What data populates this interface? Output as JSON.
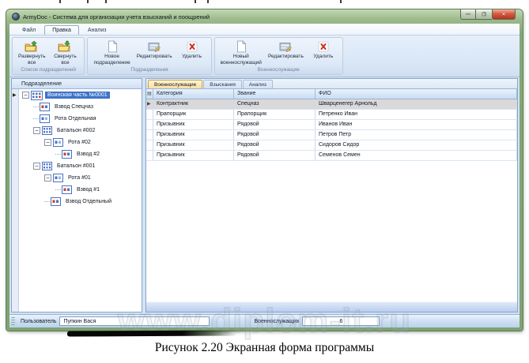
{
  "window": {
    "title": "ArmyDoc - Система для организации учета взысканий и поощрений"
  },
  "glyphs": {
    "minimize": "—",
    "maximize": "❐",
    "close": "✕",
    "row_marker": "▶",
    "collapse": "−",
    "grid_corner": "▤"
  },
  "ribbon": {
    "tabs": [
      {
        "label": "Файл",
        "active": false
      },
      {
        "label": "Правка",
        "active": true
      },
      {
        "label": "Анализ",
        "active": false
      }
    ],
    "groups": [
      {
        "caption": "Список подразделений",
        "buttons": [
          {
            "line1": "Развернуть",
            "line2": "все",
            "icon": "folder-expand"
          },
          {
            "line1": "Свернуть",
            "line2": "все",
            "icon": "folder-collapse"
          }
        ]
      },
      {
        "caption": "Подразделения",
        "buttons": [
          {
            "line1": "Новое",
            "line2": "подразделение",
            "icon": "new-document"
          },
          {
            "line1": "Редактировать",
            "line2": "",
            "icon": "edit-form"
          },
          {
            "line1": "Удалить",
            "line2": "",
            "icon": "delete"
          }
        ]
      },
      {
        "caption": "Военнослужащие",
        "buttons": [
          {
            "line1": "Новый",
            "line2": "военнослужащий",
            "icon": "new-document"
          },
          {
            "line1": "Редактировать",
            "line2": "",
            "icon": "edit-form"
          },
          {
            "line1": "Удалить",
            "line2": "",
            "icon": "delete"
          }
        ]
      }
    ]
  },
  "tree": {
    "header": "Подразделение",
    "items": [
      {
        "label": "Воинская часть №0001",
        "level": 0,
        "expandable": true,
        "icon": "unit",
        "selected": true
      },
      {
        "label": "Взвод Спецназ",
        "level": 1,
        "expandable": false,
        "icon": "platoon",
        "selected": false
      },
      {
        "label": "Рота Отдельная",
        "level": 1,
        "expandable": false,
        "icon": "company",
        "selected": false
      },
      {
        "label": "Батальон #002",
        "level": 1,
        "expandable": true,
        "icon": "battalion",
        "selected": false
      },
      {
        "label": "Рота #02",
        "level": 2,
        "expandable": true,
        "icon": "company",
        "selected": false
      },
      {
        "label": "Взвод #2",
        "level": 3,
        "expandable": false,
        "icon": "platoon",
        "selected": false
      },
      {
        "label": "Батальон #001",
        "level": 1,
        "expandable": true,
        "icon": "battalion",
        "selected": false
      },
      {
        "label": "Рота #01",
        "level": 2,
        "expandable": true,
        "icon": "company",
        "selected": false
      },
      {
        "label": "Взвод #1",
        "level": 3,
        "expandable": false,
        "icon": "platoon",
        "selected": false
      },
      {
        "label": "Взвод Отдельный",
        "level": 2,
        "expandable": false,
        "icon": "platoon",
        "selected": false
      }
    ]
  },
  "detail": {
    "tabs": [
      {
        "label": "Военнослужащие",
        "active": true
      },
      {
        "label": "Взыскания",
        "active": false
      },
      {
        "label": "Анализ",
        "active": false
      }
    ],
    "table": {
      "columns": [
        "Категория",
        "Звание",
        "ФИО"
      ],
      "selected_row": 0,
      "rows": [
        [
          "Контрактник",
          "Спецназ",
          "Шварценегер Арнольд"
        ],
        [
          "Прапорщик",
          "Прапорщик",
          "Петренко Иван"
        ],
        [
          "Призывник",
          "Рядовой",
          "Иванов Иван"
        ],
        [
          "Призывник",
          "Рядовой",
          "Петров Петр"
        ],
        [
          "Призывник",
          "Рядовой",
          "Сидоров Сидор"
        ],
        [
          "Призывник",
          "Рядовой",
          "Семенов Семен"
        ]
      ]
    }
  },
  "statusbar": {
    "user_label": "Пользователь",
    "user_value": "Пупкин Вася",
    "count_label": "Военнослужащих",
    "count_value": "6"
  },
  "watermark": "www.diplom-it.ru",
  "caption": "Рисунок 2.20 Экранная форма программы",
  "colors": {
    "frame_green": "#84a875",
    "ribbon_blue": "#d8e6f6",
    "selection_blue": "#3e73c9",
    "active_tab_tan": "#f7dfa4",
    "grid_header_blue": "#c9dcf3",
    "close_red": "#b43322",
    "watermark_gray": "#a5b1bd"
  }
}
